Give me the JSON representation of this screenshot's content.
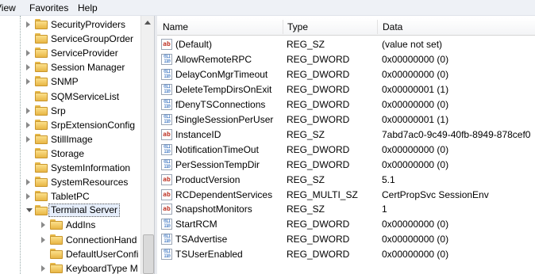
{
  "menu": {
    "view": "View",
    "favorites": "Favorites",
    "help": "Help"
  },
  "tree": {
    "items": [
      {
        "label": "SecurityProviders",
        "expandable": true
      },
      {
        "label": "ServiceGroupOrder",
        "expandable": false
      },
      {
        "label": "ServiceProvider",
        "expandable": true
      },
      {
        "label": "Session Manager",
        "expandable": true
      },
      {
        "label": "SNMP",
        "expandable": true
      },
      {
        "label": "SQMServiceList",
        "expandable": false
      },
      {
        "label": "Srp",
        "expandable": true
      },
      {
        "label": "SrpExtensionConfig",
        "expandable": true
      },
      {
        "label": "StillImage",
        "expandable": true
      },
      {
        "label": "Storage",
        "expandable": false
      },
      {
        "label": "SystemInformation",
        "expandable": false
      },
      {
        "label": "SystemResources",
        "expandable": true
      },
      {
        "label": "TabletPC",
        "expandable": true
      },
      {
        "label": "Terminal Server",
        "expandable": true,
        "open": true,
        "selected": true
      }
    ],
    "children": [
      {
        "label": "AddIns",
        "expandable": true
      },
      {
        "label": "ConnectionHand",
        "expandable": true
      },
      {
        "label": "DefaultUserConfi",
        "expandable": false
      },
      {
        "label": "KeyboardType M",
        "expandable": true
      }
    ]
  },
  "columns": {
    "name": "Name",
    "type": "Type",
    "data": "Data"
  },
  "values": [
    {
      "icon": "sz",
      "name": "(Default)",
      "type": "REG_SZ",
      "data": "(value not set)"
    },
    {
      "icon": "dword",
      "name": "AllowRemoteRPC",
      "type": "REG_DWORD",
      "data": "0x00000000 (0)"
    },
    {
      "icon": "dword",
      "name": "DelayConMgrTimeout",
      "type": "REG_DWORD",
      "data": "0x00000000 (0)"
    },
    {
      "icon": "dword",
      "name": "DeleteTempDirsOnExit",
      "type": "REG_DWORD",
      "data": "0x00000001 (1)"
    },
    {
      "icon": "dword",
      "name": "fDenyTSConnections",
      "type": "REG_DWORD",
      "data": "0x00000000 (0)"
    },
    {
      "icon": "dword",
      "name": "fSingleSessionPerUser",
      "type": "REG_DWORD",
      "data": "0x00000001 (1)"
    },
    {
      "icon": "sz",
      "name": "InstanceID",
      "type": "REG_SZ",
      "data": "7abd7ac0-9c49-40fb-8949-878cef0"
    },
    {
      "icon": "dword",
      "name": "NotificationTimeOut",
      "type": "REG_DWORD",
      "data": "0x00000000 (0)"
    },
    {
      "icon": "dword",
      "name": "PerSessionTempDir",
      "type": "REG_DWORD",
      "data": "0x00000000 (0)"
    },
    {
      "icon": "sz",
      "name": "ProductVersion",
      "type": "REG_SZ",
      "data": "5.1"
    },
    {
      "icon": "sz",
      "name": "RCDependentServices",
      "type": "REG_MULTI_SZ",
      "data": "CertPropSvc SessionEnv"
    },
    {
      "icon": "sz",
      "name": "SnapshotMonitors",
      "type": "REG_SZ",
      "data": "1"
    },
    {
      "icon": "dword",
      "name": "StartRCM",
      "type": "REG_DWORD",
      "data": "0x00000000 (0)"
    },
    {
      "icon": "dword",
      "name": "TSAdvertise",
      "type": "REG_DWORD",
      "data": "0x00000000 (0)"
    },
    {
      "icon": "dword",
      "name": "TSUserEnabled",
      "type": "REG_DWORD",
      "data": "0x00000000 (0)"
    }
  ],
  "icon_glyphs": {
    "sz": "ab",
    "dword": "011\n110"
  }
}
